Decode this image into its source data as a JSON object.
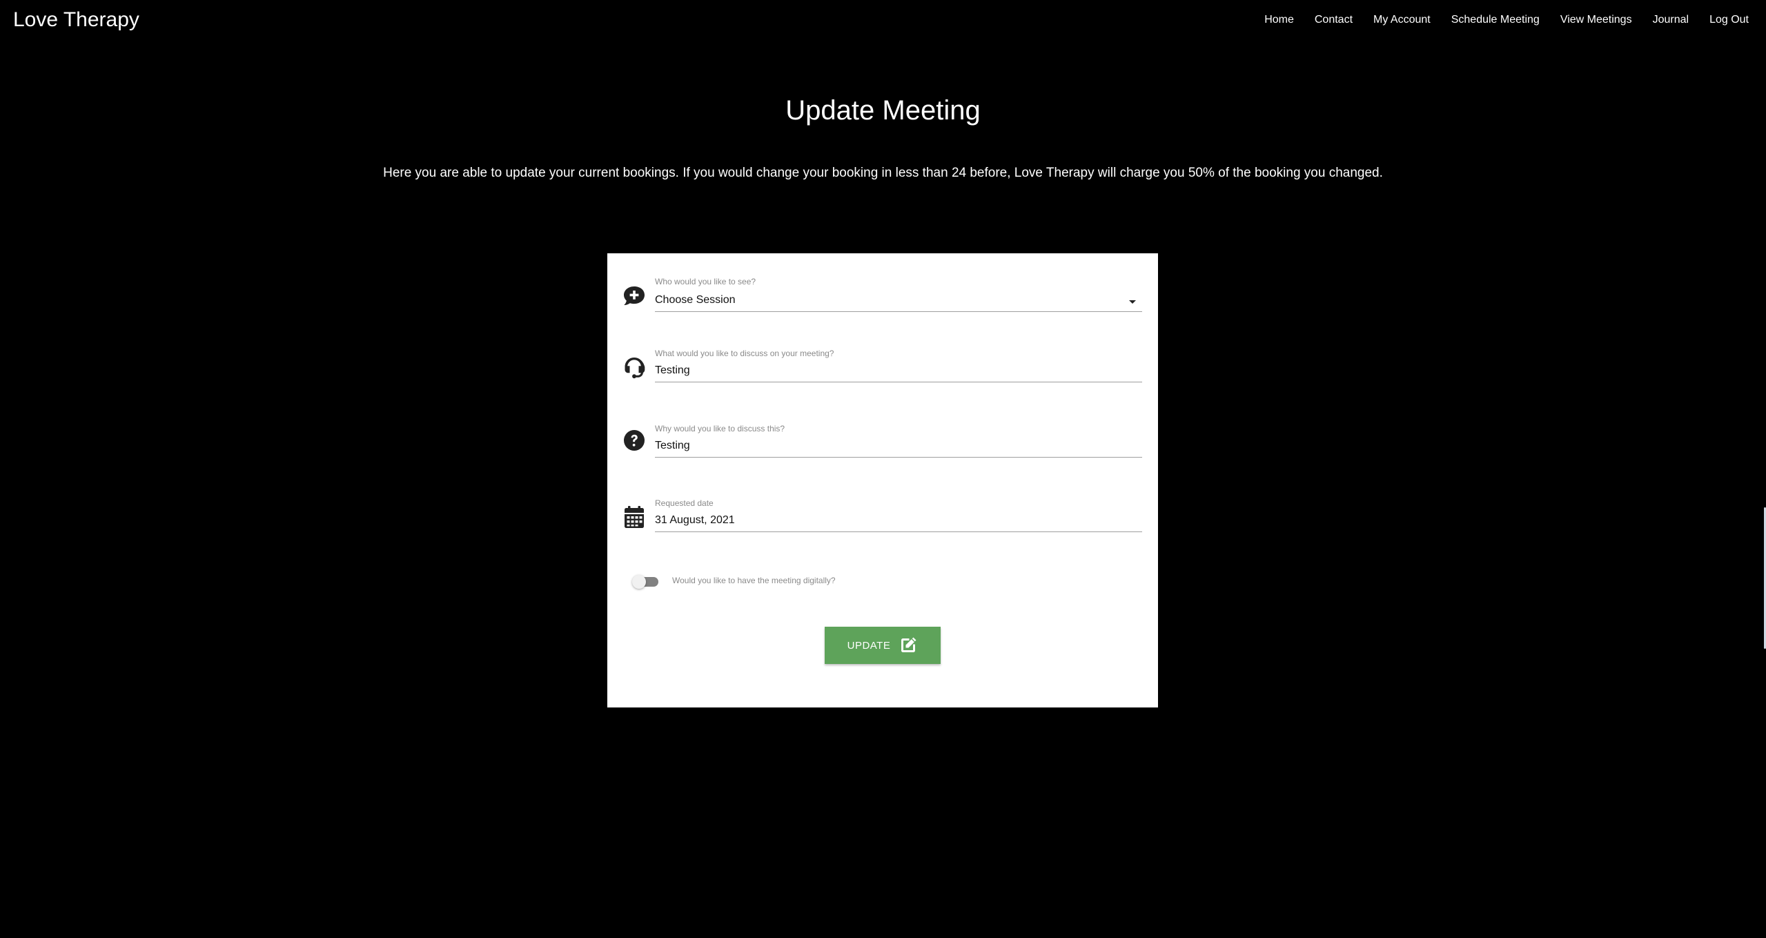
{
  "nav": {
    "brand": "Love Therapy",
    "links": [
      "Home",
      "Contact",
      "My Account",
      "Schedule Meeting",
      "View Meetings",
      "Journal",
      "Log Out"
    ]
  },
  "page": {
    "title": "Update Meeting",
    "intro": "Here you are able to update your current bookings. If you would change your booking in less than 24 before, Love Therapy will charge you 50% of the booking you changed."
  },
  "form": {
    "session": {
      "label": "Who would you like to see?",
      "value": "Choose Session",
      "icon": "comment-medical-icon"
    },
    "topic": {
      "label": "What would you like to discuss on your meeting?",
      "value": "Testing",
      "icon": "headset-icon"
    },
    "reason": {
      "label": "Why would you like to discuss this?",
      "value": "Testing",
      "icon": "question-circle-icon"
    },
    "date": {
      "label": "Requested date",
      "value": "31 August, 2021",
      "icon": "calendar-icon"
    },
    "digital": {
      "label": "Would you like to have the meeting digitally?",
      "checked": false
    },
    "submit": {
      "label": "UPDATE",
      "icon": "edit-icon",
      "color": "#5ea35a"
    }
  }
}
